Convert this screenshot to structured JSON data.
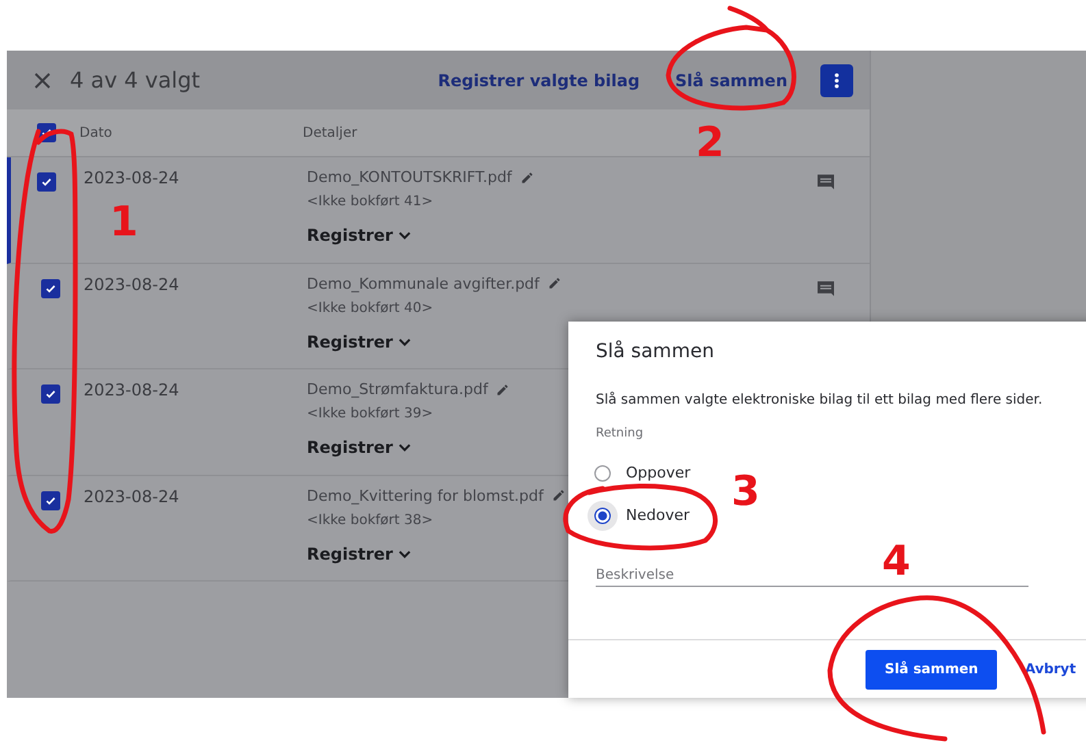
{
  "header": {
    "title": "4 av 4 valgt",
    "actions": [
      "Registrer valgte bilag",
      "Slå sammen"
    ]
  },
  "table": {
    "select_all": {
      "checked": true
    },
    "columns": [
      "Dato",
      "Detaljer"
    ],
    "rows": [
      {
        "checked": true,
        "selected": true,
        "date": "2023-08-24",
        "file": "Demo_KONTOUTSKRIFT.pdf",
        "status": "<Ikke bokført 41>",
        "action": "Registrer"
      },
      {
        "checked": true,
        "selected": false,
        "date": "2023-08-24",
        "file": "Demo_Kommunale avgifter.pdf",
        "status": "<Ikke bokført 40>",
        "action": "Registrer"
      },
      {
        "checked": true,
        "selected": false,
        "date": "2023-08-24",
        "file": "Demo_Strømfaktura.pdf",
        "status": "<Ikke bokført 39>",
        "action": "Registrer"
      },
      {
        "checked": true,
        "selected": false,
        "date": "2023-08-24",
        "file": "Demo_Kvittering for blomst.pdf",
        "status": "<Ikke bokført 38>",
        "action": "Registrer"
      }
    ]
  },
  "dialog": {
    "title": "Slå sammen",
    "text": "Slå sammen valgte elektroniske bilag til ett bilag med flere sider.",
    "group_label": "Retning",
    "options": [
      {
        "label": "Oppover",
        "selected": false
      },
      {
        "label": "Nedover",
        "selected": true
      }
    ],
    "field": {
      "placeholder": "Beskrivelse"
    },
    "buttons": [
      {
        "label": "Slå sammen",
        "kind": "primary"
      },
      {
        "label": "Avbryt",
        "kind": "link"
      }
    ]
  },
  "annotations": {
    "labels": [
      "1",
      "2",
      "3",
      "4"
    ]
  }
}
